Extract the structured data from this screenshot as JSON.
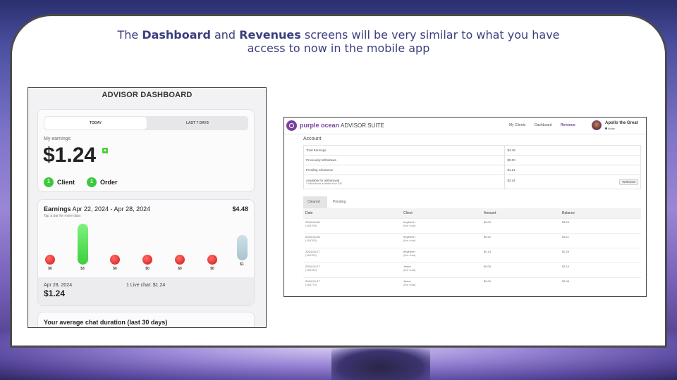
{
  "slide": {
    "headline_parts": [
      "The ",
      "Dashboard",
      " and ",
      "Revenues",
      " screens will be very similar to what you have"
    ],
    "headline_line2": "access to now in the mobile app"
  },
  "mobile": {
    "title": "ADVISOR DASHBOARD",
    "tabs": [
      "TODAY",
      "LAST 7 DAYS"
    ],
    "my_earnings_label": "My earnings",
    "amount": "$1.24",
    "stats": [
      {
        "count": "1",
        "label": "Client"
      },
      {
        "count": "1",
        "label": "Order"
      }
    ],
    "earnings": {
      "title_bold": "Earnings",
      "title_range": " Apr 22, 2024 - Apr 28, 2024",
      "total": "$4.48",
      "hint": "Tap a bar for more data",
      "bars": [
        {
          "label": "$0",
          "value": 0,
          "kind": "zero"
        },
        {
          "label": "$3",
          "value": 3,
          "kind": "green"
        },
        {
          "label": "$0",
          "value": 0,
          "kind": "zero"
        },
        {
          "label": "$0",
          "value": 0,
          "kind": "zero"
        },
        {
          "label": "$0",
          "value": 0,
          "kind": "zero"
        },
        {
          "label": "$0",
          "value": 0,
          "kind": "zero"
        },
        {
          "label": "$1",
          "value": 1,
          "kind": "selected"
        }
      ],
      "selected_date": "Apr 28, 2024",
      "selected_amount": "$1.24",
      "selected_detail": "1 Live chat: $1.24"
    },
    "avg_title": "Your average chat duration (last 30 days)"
  },
  "desktop": {
    "brand": "purple ocean",
    "brand_sub": "ADVISOR SUITE",
    "nav": [
      "My Clients",
      "Dashboard",
      "Revenue"
    ],
    "user_name": "Apollo the Great",
    "user_status": "Away",
    "account_title": "Account",
    "account_rows": [
      {
        "label": "Total Earnings",
        "value": "$4.48"
      },
      {
        "label": "Previously Withdrawn",
        "value": "$0.00"
      },
      {
        "label": "Pending Clearance",
        "value": "$1.24"
      },
      {
        "label": "Available for withdrawal",
        "note": "* Withdrawals available from $35",
        "value": "$3.24",
        "button": "Withdraw"
      }
    ],
    "tabs": [
      "Cleared",
      "Pending"
    ],
    "columns": [
      "Date",
      "Client",
      "Amount",
      "Balance"
    ],
    "rows": [
      {
        "date": "2024-04-28",
        "id": "(166790)",
        "client": "heythere!",
        "type": "(live chat)",
        "amount": "$0.03",
        "balance": "$3.24"
      },
      {
        "date": "2024-04-28",
        "id": "(166785)",
        "client": "heythere!",
        "type": "(live chat)",
        "amount": "$0.92",
        "balance": "$3.21"
      },
      {
        "date": "2024-04-27",
        "id": "(166782)",
        "client": "heythere!",
        "type": "(live chat)",
        "amount": "$0.13",
        "balance": "$2.29"
      },
      {
        "date": "2024-04-27",
        "id": "(166780)",
        "client": "Jason",
        "type": "(live chat)",
        "amount": "$0.06",
        "balance": "$2.16"
      },
      {
        "date": "2024-04-27",
        "id": "(166779)",
        "client": "Jason",
        "type": "(live chat)",
        "amount": "$0.09",
        "balance": "$2.08"
      }
    ]
  },
  "colors": {
    "brand": "#7b3fa0",
    "headline": "#3b3f7e",
    "green": "#3dc93d",
    "red": "#e53935"
  }
}
